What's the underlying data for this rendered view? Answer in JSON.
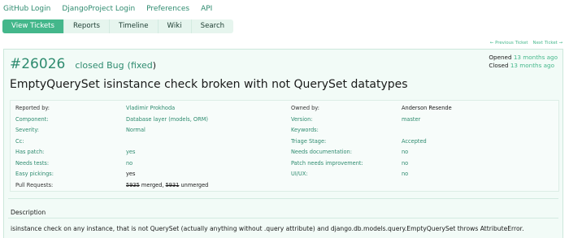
{
  "top_links": [
    "GitHub Login",
    "DjangoProject Login",
    "Preferences",
    "API"
  ],
  "tabs": [
    "View Tickets",
    "Reports",
    "Timeline",
    "Wiki",
    "Search"
  ],
  "ticket_nav": {
    "prev": "← Previous Ticket",
    "next": "Next Ticket →"
  },
  "ticket": {
    "number": "#26026",
    "status": "closed Bug",
    "resolution_open": "(",
    "resolution": "fixed",
    "resolution_close": ")",
    "opened_label": "Opened",
    "opened": "13 months ago",
    "closed_label": "Closed",
    "closed": "13 months ago",
    "summary": "EmptyQuerySet isinstance check broken with not QuerySet datatypes"
  },
  "properties": {
    "reported_by": {
      "label": "Reported by:",
      "value": "Vladimir Prokhoda"
    },
    "owned_by": {
      "label": "Owned by:",
      "value": "Anderson Resende"
    },
    "component": {
      "label": "Component:",
      "value": "Database layer (models, ORM)"
    },
    "version": {
      "label": "Version:",
      "value": "master"
    },
    "severity": {
      "label": "Severity:",
      "value": "Normal"
    },
    "keywords": {
      "label": "Keywords:",
      "value": ""
    },
    "cc": {
      "label": "Cc:",
      "value": ""
    },
    "triage_stage": {
      "label": "Triage Stage:",
      "value": "Accepted"
    },
    "has_patch": {
      "label": "Has patch:",
      "value": "yes"
    },
    "needs_documentation": {
      "label": "Needs documentation:",
      "value": "no"
    },
    "needs_tests": {
      "label": "Needs tests:",
      "value": "no"
    },
    "patch_needs_improvement": {
      "label": "Patch needs improvement:",
      "value": "no"
    },
    "easy_pickings": {
      "label": "Easy pickings:",
      "value": "yes"
    },
    "ui_ux": {
      "label": "UI/UX:",
      "value": "no"
    },
    "pull_requests": {
      "label": "Pull Requests:",
      "pr1": "5935",
      "pr1_state": "merged,",
      "pr2": "5931",
      "pr2_state": "unmerged"
    }
  },
  "description": {
    "title": "Description",
    "text": "isinstance check on any instance, that is not QuerySet (actually anything without .query attribute) and django.db.models.query.EmptyQuerySet throws AttributeError."
  },
  "colors": {
    "accent": "#44b78b",
    "link": "#2e8b6f",
    "panel_bg": "#f2fbf7"
  }
}
